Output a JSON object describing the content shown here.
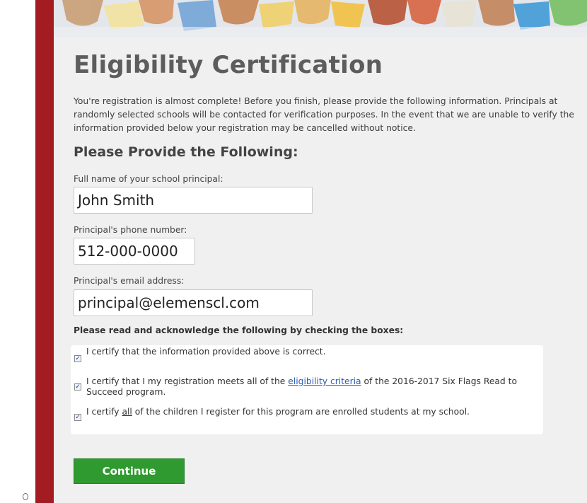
{
  "page": {
    "title": "Eligibility Certification",
    "intro": "You're registration is almost complete! Before you finish, please provide the following information. Principals at randomly selected schools will be contacted for verification purposes. In the event that we are unable to verify the information provided below your registration may be cancelled without notice.",
    "subheading": "Please Provide the Following:"
  },
  "form": {
    "principal_name": {
      "label": "Full name of your school principal:",
      "value": "John Smith"
    },
    "principal_phone": {
      "label": "Principal's phone number:",
      "value": "512-000-0000"
    },
    "principal_email": {
      "label": "Principal's email address:",
      "value": "principal@elemenscl.com"
    }
  },
  "acknowledgements": {
    "heading": "Please read and acknowledge the following by checking the boxes:",
    "items": [
      {
        "checked": true,
        "text": "I certify that the information provided above is correct."
      },
      {
        "checked": true,
        "text_before": "I certify that I my registration meets all of the ",
        "link": "eligibility criteria",
        "text_after": " of the 2016-2017 Six Flags Read to Succeed program."
      },
      {
        "checked": true,
        "text_before": "I certify ",
        "emphasis": "all",
        "text_after": " of the children I register for this program are enrolled students at my school."
      }
    ]
  },
  "continue_label": "Continue",
  "colors": {
    "side_bar": "#a31c21",
    "panel_bg": "#f0f0f0",
    "button_green": "#2f9a2f",
    "link_blue": "#2a5db0",
    "title_gray": "#5d5d5d"
  },
  "icons": {
    "banner": "children-reading-books-photo",
    "checkbox": "checkmark-icon"
  }
}
